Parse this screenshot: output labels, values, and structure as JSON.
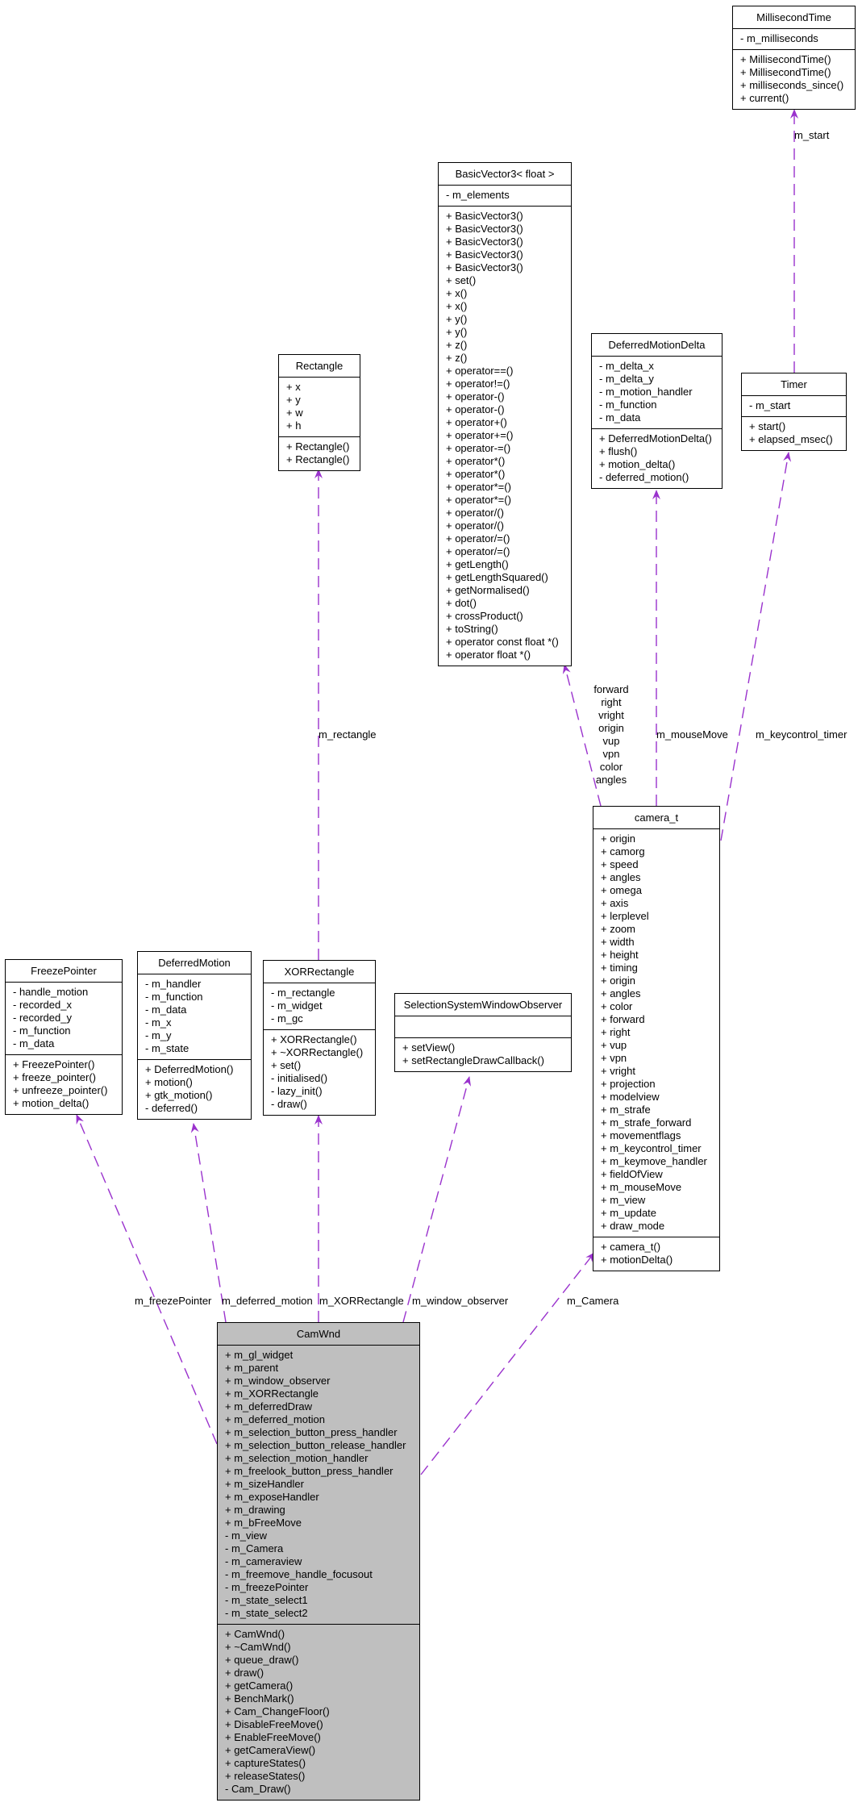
{
  "diagram": {
    "classes": {
      "millisecondtime": {
        "name": "MillisecondTime",
        "attributes": [
          "- m_milliseconds"
        ],
        "methods": [
          "+ MillisecondTime()",
          "+ MillisecondTime()",
          "+ milliseconds_since()",
          "+ current()"
        ]
      },
      "basicvector3": {
        "name": "BasicVector3< float >",
        "attributes": [
          "- m_elements"
        ],
        "methods": [
          "+ BasicVector3()",
          "+ BasicVector3()",
          "+ BasicVector3()",
          "+ BasicVector3()",
          "+ BasicVector3()",
          "+ set()",
          "+ x()",
          "+ x()",
          "+ y()",
          "+ y()",
          "+ z()",
          "+ z()",
          "+ operator==()",
          "+ operator!=()",
          "+ operator-()",
          "+ operator-()",
          "+ operator+()",
          "+ operator+=()",
          "+ operator-=()",
          "+ operator*()",
          "+ operator*()",
          "+ operator*=()",
          "+ operator*=()",
          "+ operator/()",
          "+ operator/()",
          "+ operator/=()",
          "+ operator/=()",
          "+ getLength()",
          "+ getLengthSquared()",
          "+ getNormalised()",
          "+ dot()",
          "+ crossProduct()",
          "+ toString()",
          "+ operator const float *()",
          "+ operator float *()"
        ]
      },
      "rectangle": {
        "name": "Rectangle",
        "attributes": [
          "+ x",
          "+ y",
          "+ w",
          "+ h"
        ],
        "methods": [
          "+ Rectangle()",
          "+ Rectangle()"
        ]
      },
      "deferredmotiondelta": {
        "name": "DeferredMotionDelta",
        "attributes": [
          "- m_delta_x",
          "- m_delta_y",
          "- m_motion_handler",
          "- m_function",
          "- m_data"
        ],
        "methods": [
          "+ DeferredMotionDelta()",
          "+ flush()",
          "+ motion_delta()",
          "- deferred_motion()"
        ]
      },
      "timer": {
        "name": "Timer",
        "attributes": [
          "- m_start"
        ],
        "methods": [
          "+ start()",
          "+ elapsed_msec()"
        ]
      },
      "camera_t": {
        "name": "camera_t",
        "attributes": [
          "+ origin",
          "+ camorg",
          "+ speed",
          "+ angles",
          "+ omega",
          "+ axis",
          "+ lerplevel",
          "+ zoom",
          "+ width",
          "+ height",
          "+ timing",
          "+ origin",
          "+ angles",
          "+ color",
          "+ forward",
          "+ right",
          "+ vup",
          "+ vpn",
          "+ vright",
          "+ projection",
          "+ modelview",
          "+ m_strafe",
          "+ m_strafe_forward",
          "+ movementflags",
          "+ m_keycontrol_timer",
          "+ m_keymove_handler",
          "+ fieldOfView",
          "+ m_mouseMove",
          "+ m_view",
          "+ m_update",
          "+ draw_mode"
        ],
        "methods": [
          "+ camera_t()",
          "+ motionDelta()"
        ]
      },
      "freezepointer": {
        "name": "FreezePointer",
        "attributes": [
          "- handle_motion",
          "- recorded_x",
          "- recorded_y",
          "- m_function",
          "- m_data"
        ],
        "methods": [
          "+ FreezePointer()",
          "+ freeze_pointer()",
          "+ unfreeze_pointer()",
          "+ motion_delta()"
        ]
      },
      "deferredmotion": {
        "name": "DeferredMotion",
        "attributes": [
          "- m_handler",
          "- m_function",
          "- m_data",
          "- m_x",
          "- m_y",
          "- m_state"
        ],
        "methods": [
          "+ DeferredMotion()",
          "+ motion()",
          "+ gtk_motion()",
          "- deferred()"
        ]
      },
      "xorrectangle": {
        "name": "XORRectangle",
        "attributes": [
          "- m_rectangle",
          "- m_widget",
          "- m_gc"
        ],
        "methods": [
          "+ XORRectangle()",
          "+ ~XORRectangle()",
          "+ set()",
          "- initialised()",
          "- lazy_init()",
          "- draw()"
        ]
      },
      "selectionsystemwindowobserver": {
        "name": "SelectionSystemWindowObserver",
        "attributes": [],
        "methods": [
          "+ setView()",
          "+ setRectangleDrawCallback()"
        ]
      },
      "camwnd": {
        "name": "CamWnd",
        "attributes": [
          "+ m_gl_widget",
          "+ m_parent",
          "+ m_window_observer",
          "+ m_XORRectangle",
          "+ m_deferredDraw",
          "+ m_deferred_motion",
          "+ m_selection_button_press_handler",
          "+ m_selection_button_release_handler",
          "+ m_selection_motion_handler",
          "+ m_freelook_button_press_handler",
          "+ m_sizeHandler",
          "+ m_exposeHandler",
          "+ m_drawing",
          "+ m_bFreeMove",
          "- m_view",
          "- m_Camera",
          "- m_cameraview",
          "- m_freemove_handle_focusout",
          "- m_freezePointer",
          "- m_state_select1",
          "- m_state_select2"
        ],
        "methods": [
          "+ CamWnd()",
          "+ ~CamWnd()",
          "+ queue_draw()",
          "+ draw()",
          "+ getCamera()",
          "+ BenchMark()",
          "+ Cam_ChangeFloor()",
          "+ DisableFreeMove()",
          "+ EnableFreeMove()",
          "+ getCameraView()",
          "+ captureStates()",
          "+ releaseStates()",
          "- Cam_Draw()"
        ]
      }
    },
    "edge_labels": {
      "timer_millisecondtime": "m_start",
      "xorrectangle_rectangle": "m_rectangle",
      "camera_basicvector3": [
        "forward",
        "right",
        "vright",
        "origin",
        "vup",
        "vpn",
        "color",
        "angles"
      ],
      "camera_deferredmotiondelta": "m_mouseMove",
      "camera_timer": "m_keycontrol_timer",
      "camwnd_freezepointer": "m_freezePointer",
      "camwnd_deferredmotion": "m_deferred_motion",
      "camwnd_xorrectangle": "m_XORRectangle",
      "camwnd_observer": "m_window_observer",
      "camwnd_camera": "m_Camera"
    },
    "colors": {
      "edge": "#9a32cd",
      "main_class_fill": "#bfbfbf",
      "class_fill": "#ffffff",
      "border": "#000000"
    }
  }
}
